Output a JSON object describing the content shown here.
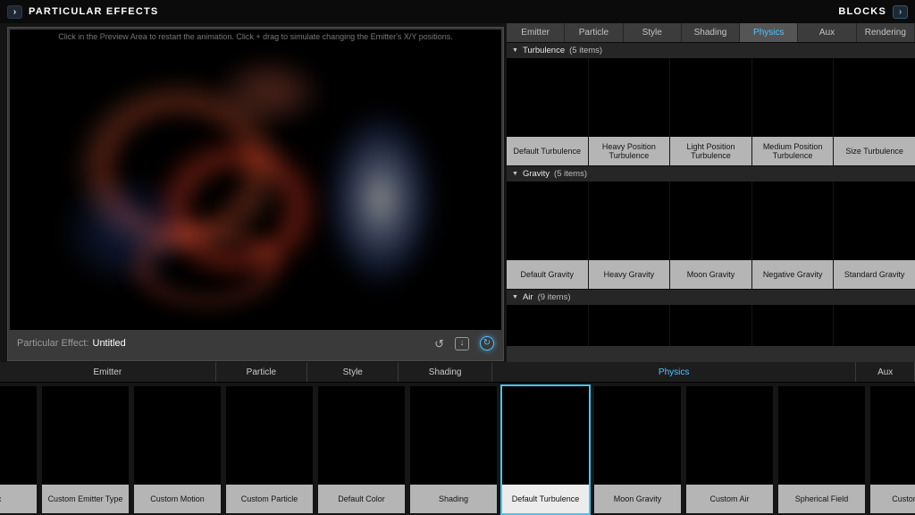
{
  "accent": "#4fc3ff",
  "glyphs": {
    "collapse": "▼",
    "chevron": "›"
  },
  "top_bar": {
    "left_title": "PARTICULAR EFFECTS",
    "right_title": "BLOCKS"
  },
  "preview": {
    "hint": "Click in the Preview Area to restart the animation. Click + drag to simulate changing the Emitter's X/Y positions.",
    "effect_label": "Particular Effect:",
    "effect_name": "Untitled",
    "icons": [
      {
        "name": "restart",
        "glyph": "↺"
      },
      {
        "name": "export",
        "glyph": "↓"
      },
      {
        "name": "sync",
        "glyph": "↻"
      }
    ]
  },
  "right_panel": {
    "tabs": [
      {
        "label": "Emitter"
      },
      {
        "label": "Particle"
      },
      {
        "label": "Style"
      },
      {
        "label": "Shading"
      },
      {
        "label": "Physics",
        "sel": "selected"
      },
      {
        "label": "Aux"
      },
      {
        "label": "Rendering"
      }
    ],
    "sections": [
      {
        "title": "Turbulence",
        "count": "(5 items)",
        "items": [
          {
            "label": "Default Turbulence",
            "art": "art-turb"
          },
          {
            "label": "Heavy Position Turbulence",
            "art": "art-turb"
          },
          {
            "label": "Light Position Turbulence",
            "art": "art-turb"
          },
          {
            "label": "Medium Position Turbulence",
            "art": "art-turb"
          },
          {
            "label": "Size Turbulence",
            "art": "art-turb-size"
          }
        ]
      },
      {
        "title": "Gravity",
        "count": "(5 items)",
        "items": [
          {
            "label": "Default Gravity",
            "art": "art-grav"
          },
          {
            "label": "Heavy Gravity",
            "art": "art-grav"
          },
          {
            "label": "Moon Gravity",
            "art": "art-grav"
          },
          {
            "label": "Negative Gravity",
            "art": "art-grav"
          },
          {
            "label": "Standard Gravity",
            "art": "art-grav"
          }
        ]
      },
      {
        "title": "Air",
        "count": "(9 items)",
        "items": [
          {
            "art": "art-air"
          },
          {
            "art": "art-air"
          },
          {
            "art": "art-air"
          },
          {
            "art": "art-air"
          },
          {
            "art": "art-air"
          }
        ]
      }
    ]
  },
  "bottom_panel": {
    "tabs": [
      {
        "label": "Emitter"
      },
      {
        "label": "Particle"
      },
      {
        "label": "Style"
      },
      {
        "label": "Shading"
      },
      {
        "label": "Physics",
        "sel": "selected"
      },
      {
        "label": "Aux"
      }
    ],
    "presets": [
      {
        "label": "/Sec",
        "art": "art-dots"
      },
      {
        "label": "Custom Emitter Type",
        "art": "art-dots2"
      },
      {
        "label": "Custom Motion",
        "art": "art-bowtie"
      },
      {
        "label": "Custom Particle",
        "art": "art-blob"
      },
      {
        "label": "Default Color",
        "art": "art-white"
      },
      {
        "label": "Shading",
        "art": "art-spheres"
      },
      {
        "label": "Default Turbulence",
        "art": "art-turb",
        "sel": "selected"
      },
      {
        "label": "Moon Gravity",
        "art": "art-grav"
      },
      {
        "label": "Custom Air",
        "art": "art-air"
      },
      {
        "label": "Spherical Field",
        "art": "art-sphere-field"
      },
      {
        "label": "Custom Aux",
        "art": "art-aux"
      }
    ]
  }
}
